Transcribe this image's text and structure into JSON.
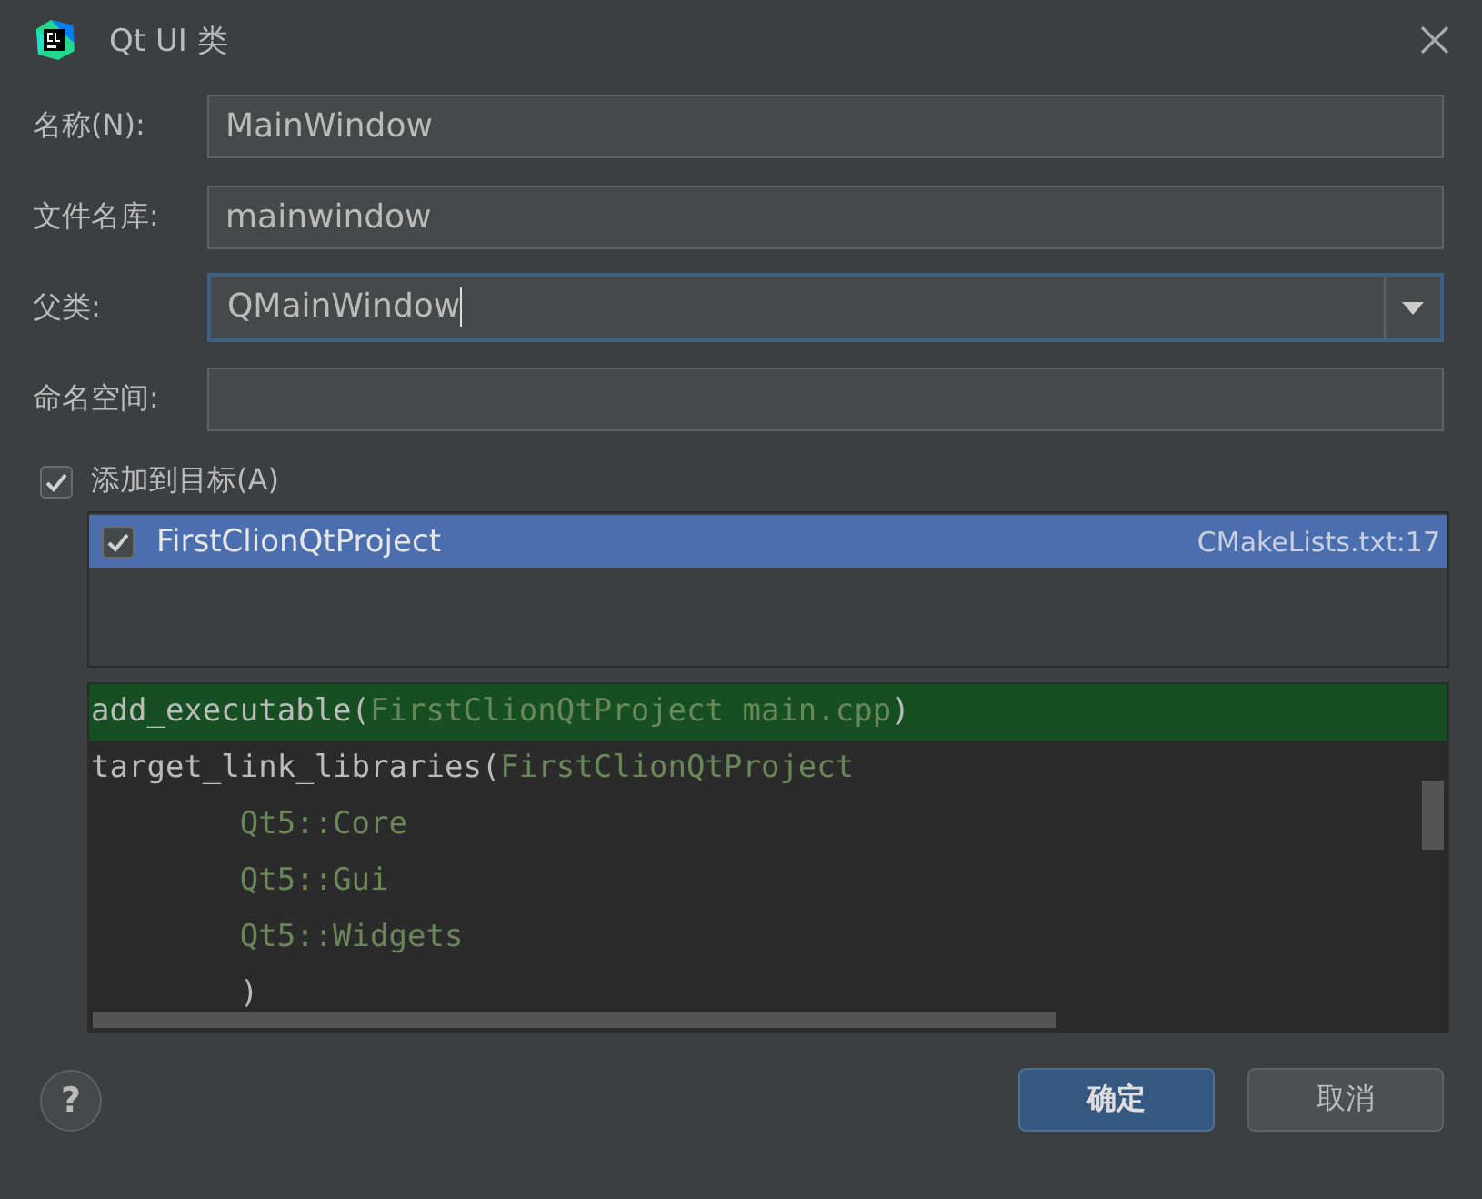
{
  "window": {
    "title": "Qt UI 类"
  },
  "fields": [
    {
      "label": "名称(N):",
      "value": "MainWindow",
      "kind": "text",
      "focused": false
    },
    {
      "label": "文件名库:",
      "value": "mainwindow",
      "kind": "text",
      "focused": false
    },
    {
      "label": "父类:",
      "value": "QMainWindow",
      "kind": "combo",
      "focused": true
    },
    {
      "label": "命名空间:",
      "kind": "text",
      "focused": false
    }
  ],
  "add_to_target": {
    "label": "添加到目标(A)",
    "checked": true
  },
  "targets": [
    {
      "name": "FirstClionQtProject",
      "location": "CMakeLists.txt:17",
      "checked": true,
      "selected": true
    }
  ],
  "code": [
    {
      "highlighted": true,
      "segments": [
        {
          "kind": "plain",
          "text": "add_executable("
        },
        {
          "kind": "arg",
          "text": "FirstClionQtProject main.cpp"
        },
        {
          "kind": "plain",
          "text": ")"
        }
      ]
    },
    {
      "highlighted": false,
      "segments": [
        {
          "kind": "plain",
          "text": "target_link_libraries("
        },
        {
          "kind": "arg",
          "text": "FirstClionQtProject"
        }
      ]
    },
    {
      "highlighted": false,
      "segments": [
        {
          "kind": "arg",
          "text": "        Qt5::Core"
        }
      ]
    },
    {
      "highlighted": false,
      "segments": [
        {
          "kind": "arg",
          "text": "        Qt5::Gui"
        }
      ]
    },
    {
      "highlighted": false,
      "segments": [
        {
          "kind": "arg",
          "text": "        Qt5::Widgets"
        }
      ]
    },
    {
      "highlighted": false,
      "segments": [
        {
          "kind": "plain",
          "text": "        )"
        }
      ]
    }
  ],
  "help": {
    "label": "?"
  },
  "buttons": [
    {
      "label": "确定",
      "kind": "primary"
    },
    {
      "label": "取消",
      "kind": "secondary"
    }
  ]
}
